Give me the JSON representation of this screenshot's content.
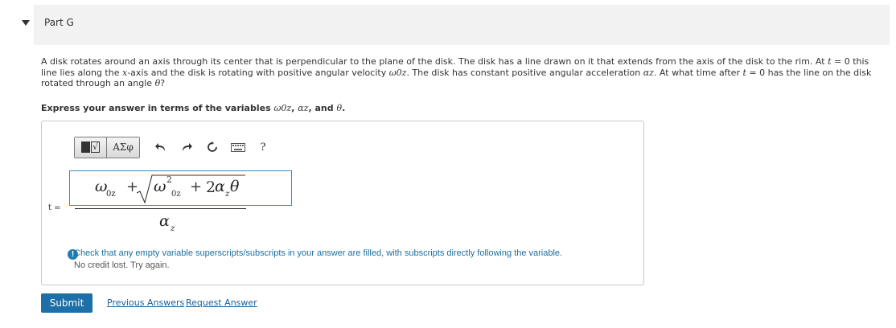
{
  "part": {
    "title": "Part G"
  },
  "problem": {
    "text_1": "A disk rotates around an axis through its center that is perpendicular to the plane of the disk. The disk has a line drawn on it that extends from the axis of the disk to the rim. At ",
    "t": "t",
    "text_2": " = 0 this line lies along the ",
    "x": "x",
    "text_3": "-axis and the disk is rotating with positive angular velocity ",
    "omega0z": "ω0z",
    "text_4": ". The disk has constant positive angular acceleration ",
    "alphaz": "αz",
    "text_5": ". At what time after ",
    "text_6": " = 0 has the line on the disk rotated through an angle ",
    "theta": "θ",
    "text_7": "?"
  },
  "instructions": {
    "prefix": "Express your answer in terms of the variables ",
    "var1": "ω0z",
    "var2": "αz",
    "conj": "and",
    "var3": "θ",
    "suffix": "."
  },
  "toolbar": {
    "greek_label": "ΑΣφ",
    "undo_icon": "undo-arrow-icon",
    "redo_icon": "redo-arrow-icon",
    "reset_icon": "reset-circle-icon",
    "keyboard_icon": "keyboard-icon",
    "help_label": "?"
  },
  "answer": {
    "variable_label": "t =",
    "numerator": {
      "omega": "ω",
      "sub_0z": "0z",
      "plus": "+",
      "omega_sq": "ω",
      "sup_2": "2",
      "sub_0z_2": "0z",
      "plus2": "+",
      "two": "2",
      "alpha": "α",
      "sub_z": "z",
      "theta": "θ"
    },
    "denominator": {
      "alpha": "α",
      "sub_z": "z"
    }
  },
  "feedback": {
    "icon": "!",
    "message": "Check that any empty variable superscripts/subscripts in your answer are filled, with subscripts directly following the variable.",
    "sub_message": "No credit lost. Try again.",
    "color": "#1b6fa0"
  },
  "actions": {
    "submit_label": "Submit",
    "previous_answers_label": "Previous Answers",
    "request_answer_label": "Request Answer"
  },
  "colors": {
    "submit_bg": "#1c6fa8",
    "input_border": "#3a8bbf",
    "header_bg": "#f2f2f2"
  }
}
